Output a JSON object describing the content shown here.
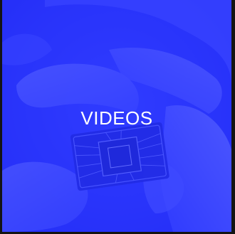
{
  "tile": {
    "label": "VIDEOS",
    "image_subject": "gloved-hand-holding-microchip-icon"
  },
  "colors": {
    "page_background": "#141414",
    "tile_tint": "#2a33ff",
    "label_text": "#ffffff"
  }
}
